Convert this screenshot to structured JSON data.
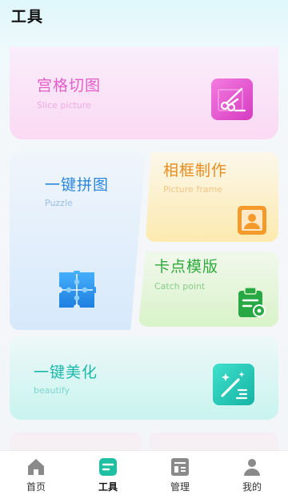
{
  "header": {
    "title": "工具"
  },
  "tools": [
    {
      "title": "宫格切图",
      "subtitle": "Slice picture",
      "icon": "scissors-icon",
      "color": "#e55cc8"
    },
    {
      "title": "一键拼图",
      "subtitle": "Puzzle",
      "icon": "puzzle-icon",
      "color": "#2a86df"
    },
    {
      "title": "相框制作",
      "subtitle": "Picture frame",
      "icon": "portrait-frame-icon",
      "color": "#ea8a1c"
    },
    {
      "title": "卡点模版",
      "subtitle": "Catch point",
      "icon": "clipboard-icon",
      "color": "#2eaa3c"
    },
    {
      "title": "一键美化",
      "subtitle": "beautify",
      "icon": "magic-wand-icon",
      "color": "#1cb9aa"
    }
  ],
  "bottom_nav": {
    "items": [
      {
        "label": "首页",
        "icon": "home-icon",
        "active": false
      },
      {
        "label": "工具",
        "icon": "tools-icon",
        "active": true
      },
      {
        "label": "管理",
        "icon": "manage-icon",
        "active": false
      },
      {
        "label": "我的",
        "icon": "profile-icon",
        "active": false
      }
    ],
    "active_color": "#1fbfa3",
    "inactive_color": "#8a8a8a"
  }
}
